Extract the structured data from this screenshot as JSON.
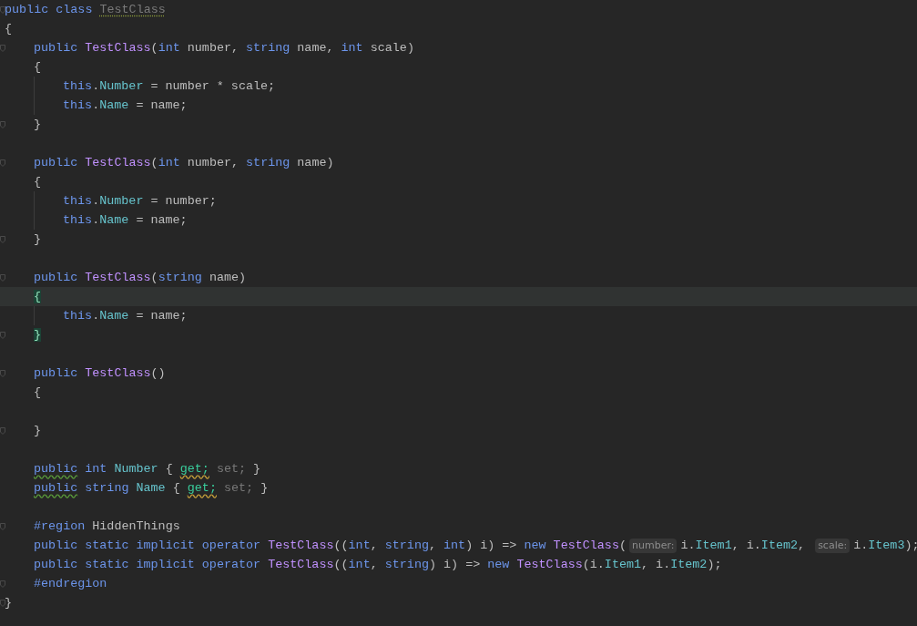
{
  "editor": {
    "lines": [
      {
        "kind": "top_code",
        "fold": true,
        "tokens": [
          {
            "text": "public class ",
            "kind": "keyword"
          },
          {
            "text": "TestClass",
            "kind": "class_unused",
            "unused": true
          }
        ]
      },
      {
        "kind": "top_code",
        "tokens": [
          {
            "text": "{",
            "kind": "plain"
          }
        ]
      },
      {
        "kind": "member_code",
        "fold": true,
        "tokens": [
          {
            "text": "public ",
            "kind": "keyword"
          },
          {
            "text": "TestClass",
            "kind": "class"
          },
          {
            "text": "(",
            "kind": "plain"
          },
          {
            "text": "int ",
            "kind": "keyword"
          },
          {
            "text": "number, ",
            "kind": "plain"
          },
          {
            "text": "string ",
            "kind": "keyword"
          },
          {
            "text": "name, ",
            "kind": "plain"
          },
          {
            "text": "int ",
            "kind": "keyword"
          },
          {
            "text": "scale)",
            "kind": "plain"
          }
        ]
      },
      {
        "kind": "member_code",
        "tokens": [
          {
            "text": "{",
            "kind": "plain"
          }
        ]
      },
      {
        "kind": "body_code",
        "guide": true,
        "tokens": [
          {
            "text": "this",
            "kind": "keyword"
          },
          {
            "text": ".",
            "kind": "plain"
          },
          {
            "text": "Number",
            "kind": "member"
          },
          {
            "text": " = number * scale;",
            "kind": "plain"
          }
        ]
      },
      {
        "kind": "body_code",
        "guide": true,
        "tokens": [
          {
            "text": "this",
            "kind": "keyword"
          },
          {
            "text": ".",
            "kind": "plain"
          },
          {
            "text": "Name",
            "kind": "member"
          },
          {
            "text": " = name;",
            "kind": "plain"
          }
        ]
      },
      {
        "kind": "member_code",
        "fold": true,
        "tokens": [
          {
            "text": "}",
            "kind": "plain"
          }
        ]
      },
      {
        "kind": "blank"
      },
      {
        "kind": "member_code",
        "fold": true,
        "tokens": [
          {
            "text": "public ",
            "kind": "keyword"
          },
          {
            "text": "TestClass",
            "kind": "class"
          },
          {
            "text": "(",
            "kind": "plain"
          },
          {
            "text": "int ",
            "kind": "keyword"
          },
          {
            "text": "number, ",
            "kind": "plain"
          },
          {
            "text": "string ",
            "kind": "keyword"
          },
          {
            "text": "name)",
            "kind": "plain"
          }
        ]
      },
      {
        "kind": "member_code",
        "tokens": [
          {
            "text": "{",
            "kind": "plain"
          }
        ]
      },
      {
        "kind": "body_code",
        "guide": true,
        "tokens": [
          {
            "text": "this",
            "kind": "keyword"
          },
          {
            "text": ".",
            "kind": "plain"
          },
          {
            "text": "Number",
            "kind": "member"
          },
          {
            "text": " = number;",
            "kind": "plain"
          }
        ]
      },
      {
        "kind": "body_code",
        "guide": true,
        "tokens": [
          {
            "text": "this",
            "kind": "keyword"
          },
          {
            "text": ".",
            "kind": "plain"
          },
          {
            "text": "Name",
            "kind": "member"
          },
          {
            "text": " = name;",
            "kind": "plain"
          }
        ]
      },
      {
        "kind": "member_code",
        "fold": true,
        "tokens": [
          {
            "text": "}",
            "kind": "plain"
          }
        ]
      },
      {
        "kind": "blank"
      },
      {
        "kind": "member_code",
        "fold": true,
        "tokens": [
          {
            "text": "public ",
            "kind": "keyword"
          },
          {
            "text": "TestClass",
            "kind": "class"
          },
          {
            "text": "(",
            "kind": "plain"
          },
          {
            "text": "string ",
            "kind": "keyword"
          },
          {
            "text": "name)",
            "kind": "plain"
          }
        ]
      },
      {
        "kind": "member_code",
        "current": true,
        "tokens": [
          {
            "text": "{",
            "kind": "plain",
            "matched": true
          }
        ]
      },
      {
        "kind": "body_code",
        "guide": true,
        "tokens": [
          {
            "text": "this",
            "kind": "keyword"
          },
          {
            "text": ".",
            "kind": "plain"
          },
          {
            "text": "Name",
            "kind": "member"
          },
          {
            "text": " = name;",
            "kind": "plain"
          }
        ]
      },
      {
        "kind": "member_code",
        "fold": true,
        "tokens": [
          {
            "text": "}",
            "kind": "plain",
            "matched": true
          }
        ]
      },
      {
        "kind": "blank"
      },
      {
        "kind": "member_code",
        "fold": true,
        "tokens": [
          {
            "text": "public ",
            "kind": "keyword"
          },
          {
            "text": "TestClass",
            "kind": "class"
          },
          {
            "text": "()",
            "kind": "plain"
          }
        ]
      },
      {
        "kind": "member_code",
        "tokens": [
          {
            "text": "{",
            "kind": "plain"
          }
        ]
      },
      {
        "kind": "blank"
      },
      {
        "kind": "member_code",
        "fold": true,
        "tokens": [
          {
            "text": "}",
            "kind": "plain"
          }
        ]
      },
      {
        "kind": "blank"
      },
      {
        "kind": "member_code",
        "tokens": [
          {
            "text": "public",
            "kind": "keyword",
            "suggestion": true
          },
          {
            "text": " int ",
            "kind": "keyword"
          },
          {
            "text": "Number",
            "kind": "member"
          },
          {
            "text": " { ",
            "kind": "plain"
          },
          {
            "text": "get;",
            "kind": "accessor",
            "warning": true
          },
          {
            "text": " set; ",
            "kind": "muted"
          },
          {
            "text": "}",
            "kind": "plain"
          }
        ]
      },
      {
        "kind": "member_code",
        "tokens": [
          {
            "text": "public",
            "kind": "keyword",
            "suggestion": true
          },
          {
            "text": " string ",
            "kind": "keyword"
          },
          {
            "text": "Name",
            "kind": "member"
          },
          {
            "text": " { ",
            "kind": "plain"
          },
          {
            "text": "get;",
            "kind": "accessor",
            "warning": true
          },
          {
            "text": " set; ",
            "kind": "muted"
          },
          {
            "text": "}",
            "kind": "plain"
          }
        ]
      },
      {
        "kind": "blank"
      },
      {
        "kind": "member_code",
        "fold": true,
        "tokens": [
          {
            "text": "#region ",
            "kind": "keyword"
          },
          {
            "text": "HiddenThings",
            "kind": "plain"
          }
        ]
      },
      {
        "kind": "member_code",
        "tokens": [
          {
            "text": "public static implicit operator ",
            "kind": "keyword"
          },
          {
            "text": "TestClass",
            "kind": "class"
          },
          {
            "text": "((",
            "kind": "plain"
          },
          {
            "text": "int",
            "kind": "keyword"
          },
          {
            "text": ", ",
            "kind": "plain"
          },
          {
            "text": "string",
            "kind": "keyword"
          },
          {
            "text": ", ",
            "kind": "plain"
          },
          {
            "text": "int",
            "kind": "keyword"
          },
          {
            "text": ") i) => ",
            "kind": "plain"
          },
          {
            "text": "new ",
            "kind": "keyword"
          },
          {
            "text": "TestClass",
            "kind": "class"
          },
          {
            "text": "(",
            "kind": "plain"
          },
          {
            "text": "number:",
            "kind": "hint"
          },
          {
            "text": "i.",
            "kind": "plain"
          },
          {
            "text": "Item1",
            "kind": "member"
          },
          {
            "text": ", i.",
            "kind": "plain"
          },
          {
            "text": "Item2",
            "kind": "member"
          },
          {
            "text": ", ",
            "kind": "plain"
          },
          {
            "text": "scale:",
            "kind": "hint"
          },
          {
            "text": "i.",
            "kind": "plain"
          },
          {
            "text": "Item3",
            "kind": "member"
          },
          {
            "text": ");",
            "kind": "plain"
          }
        ]
      },
      {
        "kind": "member_code",
        "tokens": [
          {
            "text": "public static implicit operator ",
            "kind": "keyword"
          },
          {
            "text": "TestClass",
            "kind": "class"
          },
          {
            "text": "((",
            "kind": "plain"
          },
          {
            "text": "int",
            "kind": "keyword"
          },
          {
            "text": ", ",
            "kind": "plain"
          },
          {
            "text": "string",
            "kind": "keyword"
          },
          {
            "text": ") i) => ",
            "kind": "plain"
          },
          {
            "text": "new ",
            "kind": "keyword"
          },
          {
            "text": "TestClass",
            "kind": "class"
          },
          {
            "text": "(i.",
            "kind": "plain"
          },
          {
            "text": "Item1",
            "kind": "member"
          },
          {
            "text": ", i.",
            "kind": "plain"
          },
          {
            "text": "Item2",
            "kind": "member"
          },
          {
            "text": ");",
            "kind": "plain"
          }
        ]
      },
      {
        "kind": "member_code",
        "fold": true,
        "tokens": [
          {
            "text": "#endregion",
            "kind": "keyword"
          }
        ]
      },
      {
        "kind": "top_code",
        "fold": true,
        "tokens": [
          {
            "text": "}",
            "kind": "plain"
          }
        ]
      }
    ]
  }
}
